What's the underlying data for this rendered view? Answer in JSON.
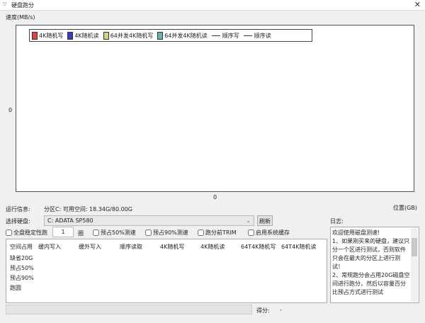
{
  "window": {
    "title": "硬盘跑分",
    "close": "✕",
    "menu_icon": "▽"
  },
  "chart": {
    "ylabel": "速度(MB/s)",
    "y0": "0",
    "x0": "0",
    "xlabel": "位置(GB)",
    "legend": [
      {
        "label": "4K随机写",
        "color": "#e84040",
        "type": "box"
      },
      {
        "label": "4K随机读",
        "color": "#3a3ac8",
        "type": "box"
      },
      {
        "label": "64并发4K随机写",
        "color": "#d8d080",
        "type": "box"
      },
      {
        "label": "64并发4K随机读",
        "color": "#60b8b0",
        "type": "box"
      },
      {
        "label": "顺序写",
        "type": "line"
      },
      {
        "label": "顺序读",
        "type": "line"
      }
    ]
  },
  "info": {
    "label": "运行信息:",
    "value": "分区C: 可用空间: 18.34G/80.00G"
  },
  "disk": {
    "label": "选择硬盘:",
    "value": "C: ADATA SP580",
    "refresh": "刷新"
  },
  "options": {
    "stability": "全盘稳定性跑",
    "rounds": "1",
    "rounds_unit": "圈",
    "pre50": "预占50%测速",
    "pre90": "预占90%测速",
    "trim": "跑分前TRIM",
    "cache": "启用系统缓存"
  },
  "table": {
    "headers": [
      "空间占用",
      "缓内写入",
      "缓外写入",
      "顺序读取",
      "4K随机写",
      "4K随机读",
      "64T4K随机写",
      "64T4K随机读"
    ],
    "rows": [
      "缺省20G",
      "预占50%",
      "预占90%",
      "跑圆"
    ]
  },
  "log": {
    "label": "日志:",
    "text": "欢迎使用磁盘测速!\n1、如果刚买来的硬盘，建议只分一个区进行测试，否则软件只会在最大的分区上进行测试！\n2、常规跑分会占用20G磁盘空间进行跑分，然后以容量百分比预占方式进行测试"
  },
  "score": {
    "label": "得分:",
    "value": "-"
  }
}
